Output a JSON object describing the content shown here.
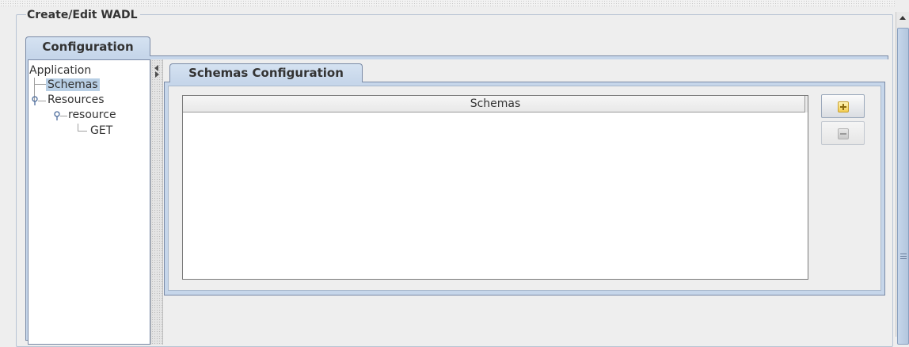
{
  "panel": {
    "title": "Create/Edit WADL"
  },
  "outer_tabs": [
    {
      "label": "Configuration",
      "selected": true
    }
  ],
  "tree": {
    "nodes": [
      {
        "label": "Application",
        "level": 0,
        "expanded": true
      },
      {
        "label": "Schemas",
        "level": 1,
        "selected": true
      },
      {
        "label": "Resources",
        "level": 1,
        "expanded": true
      },
      {
        "label": "resource",
        "level": 2,
        "expanded": true
      },
      {
        "label": "GET",
        "level": 3
      }
    ]
  },
  "inner_tabs": [
    {
      "label": "Schemas Configuration",
      "selected": true
    }
  ],
  "schemas_table": {
    "columns": [
      "Schemas"
    ],
    "rows": []
  },
  "buttons": {
    "add": {
      "icon": "add-icon",
      "enabled": true
    },
    "remove": {
      "icon": "remove-icon",
      "enabled": false
    }
  },
  "colors": {
    "tab_selected": "#c6d6ea",
    "tree_selection": "#b8cfe5",
    "border_accent": "#7a8aa6"
  }
}
